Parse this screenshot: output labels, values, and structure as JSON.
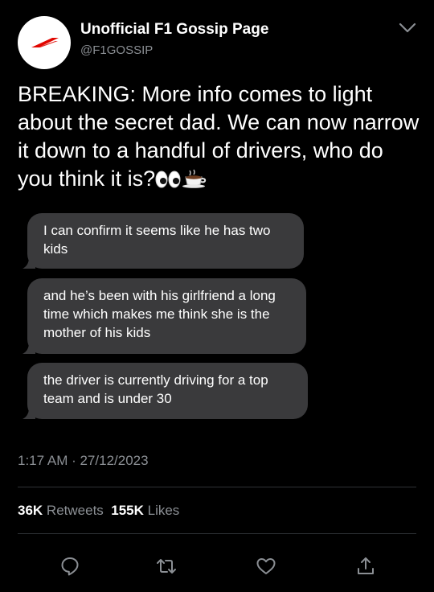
{
  "tweet": {
    "author": {
      "display_name": "Unofficial F1 Gossip Page",
      "handle": "@F1GOSSIP",
      "avatar_icon": "f1-logo-icon"
    },
    "text": "BREAKING: More info comes to light about the secret dad. We can now narrow it down to a handful of drivers, who do you think it is?",
    "emoji_icons": [
      "eyes-icon",
      "coffee-cup-icon"
    ],
    "messages": [
      {
        "text": "I can confirm it seems like he has two kids"
      },
      {
        "text": "and he’s been with his girlfriend a long time which makes me think she is the mother of his kids"
      },
      {
        "text": "the driver is currently driving for a top team and is under 30"
      }
    ],
    "timestamp": "1:17 AM · 27/12/2023",
    "stats": {
      "retweets_count": "36K",
      "retweets_label": "Retweets",
      "likes_count": "155K",
      "likes_label": "Likes"
    },
    "actions": [
      "reply-icon",
      "retweet-icon",
      "like-icon",
      "share-icon"
    ]
  },
  "colors": {
    "background": "#000000",
    "text_primary": "#ffffff",
    "text_secondary": "#8b8f94",
    "bubble": "#3a3a3c",
    "divider": "#2f3336",
    "brand_red": "#e10600"
  }
}
